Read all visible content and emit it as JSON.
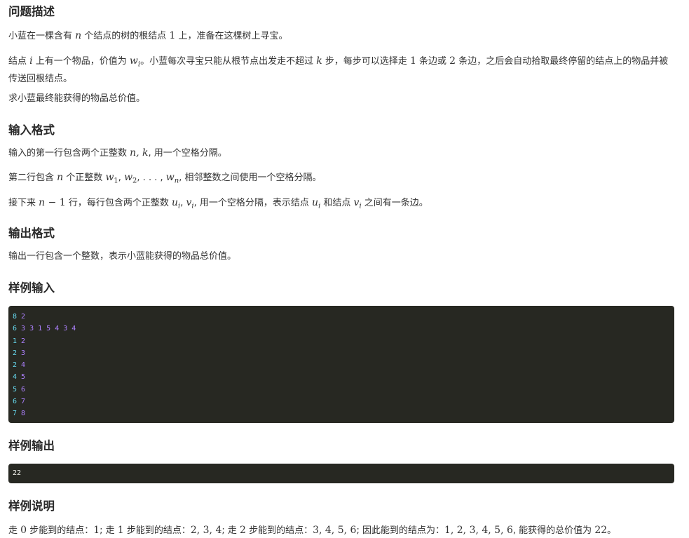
{
  "sections": {
    "description_title": "问题描述",
    "input_title": "输入格式",
    "output_title": "输出格式",
    "sample_input_title": "样例输入",
    "sample_output_title": "样例输出",
    "sample_explain_title": "样例说明"
  },
  "description": {
    "p1": [
      "小蓝在一棵含有 ",
      "n",
      " 个结点的树的根结点 ",
      "1",
      " 上，准备在这棵树上寻宝。"
    ],
    "p2": [
      "结点 ",
      "i",
      " 上有一个物品，价值为 ",
      "w",
      "i",
      "。小蓝每次寻宝只能从根节点出发走不超过 ",
      "k",
      " 步，每步可以选择走 ",
      "1",
      " 条边或 ",
      "2",
      " 条边，之后会自动拾取最终停留的结点上的物品并被传送回根结点。"
    ],
    "p3": "求小蓝最终能获得的物品总价值。"
  },
  "input_format": {
    "l1": [
      "输入的第一行包含两个正整数 ",
      "n, k",
      ", 用一个空格分隔。"
    ],
    "l2": [
      "第二行包含 ",
      "n",
      " 个正整数 ",
      "w",
      "1",
      ", ",
      "w",
      "2",
      ", . . . , ",
      "w",
      "n",
      ", 相邻整数之间使用一个空格分隔。"
    ],
    "l3": [
      "接下来 ",
      "n",
      " − ",
      "1",
      " 行，每行包含两个正整数 ",
      "u",
      "i",
      ", ",
      "v",
      "i",
      ", 用一个空格分隔，表示结点 ",
      "u",
      "i",
      " 和结点 ",
      "v",
      "i",
      " 之间有一条边。"
    ]
  },
  "output_format": {
    "l1": "输出一行包含一个整数，表示小蓝能获得的物品总价值。"
  },
  "sample_input": [
    {
      "first": "8",
      "rest": " 2"
    },
    {
      "first": "6",
      "rest": " 3 3 1 5 4 3 4"
    },
    {
      "first": "1",
      "rest": " 2"
    },
    {
      "first": "2",
      "rest": " 3"
    },
    {
      "first": "2",
      "rest": " 4"
    },
    {
      "first": "4",
      "rest": " 5"
    },
    {
      "first": "5",
      "rest": " 6"
    },
    {
      "first": "6",
      "rest": " 7"
    },
    {
      "first": "7",
      "rest": " 8"
    }
  ],
  "sample_output": "22",
  "sample_explain": [
    "走 ",
    "0",
    " 步能到的结点：",
    "1",
    "; 走 ",
    "1",
    " 步能到的结点：",
    "2, 3, 4",
    "; 走 ",
    "2",
    " 步能到的结点：",
    "3, 4, 5, 6",
    "; 因此能到的结点为：",
    "1, 2, 3, 4, 5, 6",
    ", 能获得的总价值为 ",
    "22",
    "。"
  ]
}
